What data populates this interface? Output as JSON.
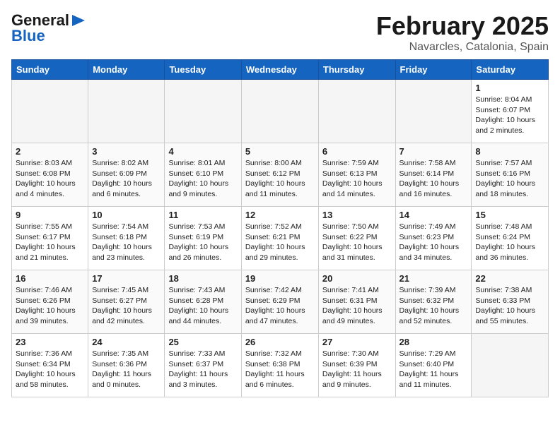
{
  "logo": {
    "line1": "General",
    "line2": "Blue",
    "arrow": "▶"
  },
  "title": "February 2025",
  "location": "Navarcles, Catalonia, Spain",
  "weekdays": [
    "Sunday",
    "Monday",
    "Tuesday",
    "Wednesday",
    "Thursday",
    "Friday",
    "Saturday"
  ],
  "weeks": [
    [
      {
        "day": "",
        "info": ""
      },
      {
        "day": "",
        "info": ""
      },
      {
        "day": "",
        "info": ""
      },
      {
        "day": "",
        "info": ""
      },
      {
        "day": "",
        "info": ""
      },
      {
        "day": "",
        "info": ""
      },
      {
        "day": "1",
        "info": "Sunrise: 8:04 AM\nSunset: 6:07 PM\nDaylight: 10 hours and 2 minutes."
      }
    ],
    [
      {
        "day": "2",
        "info": "Sunrise: 8:03 AM\nSunset: 6:08 PM\nDaylight: 10 hours and 4 minutes."
      },
      {
        "day": "3",
        "info": "Sunrise: 8:02 AM\nSunset: 6:09 PM\nDaylight: 10 hours and 6 minutes."
      },
      {
        "day": "4",
        "info": "Sunrise: 8:01 AM\nSunset: 6:10 PM\nDaylight: 10 hours and 9 minutes."
      },
      {
        "day": "5",
        "info": "Sunrise: 8:00 AM\nSunset: 6:12 PM\nDaylight: 10 hours and 11 minutes."
      },
      {
        "day": "6",
        "info": "Sunrise: 7:59 AM\nSunset: 6:13 PM\nDaylight: 10 hours and 14 minutes."
      },
      {
        "day": "7",
        "info": "Sunrise: 7:58 AM\nSunset: 6:14 PM\nDaylight: 10 hours and 16 minutes."
      },
      {
        "day": "8",
        "info": "Sunrise: 7:57 AM\nSunset: 6:16 PM\nDaylight: 10 hours and 18 minutes."
      }
    ],
    [
      {
        "day": "9",
        "info": "Sunrise: 7:55 AM\nSunset: 6:17 PM\nDaylight: 10 hours and 21 minutes."
      },
      {
        "day": "10",
        "info": "Sunrise: 7:54 AM\nSunset: 6:18 PM\nDaylight: 10 hours and 23 minutes."
      },
      {
        "day": "11",
        "info": "Sunrise: 7:53 AM\nSunset: 6:19 PM\nDaylight: 10 hours and 26 minutes."
      },
      {
        "day": "12",
        "info": "Sunrise: 7:52 AM\nSunset: 6:21 PM\nDaylight: 10 hours and 29 minutes."
      },
      {
        "day": "13",
        "info": "Sunrise: 7:50 AM\nSunset: 6:22 PM\nDaylight: 10 hours and 31 minutes."
      },
      {
        "day": "14",
        "info": "Sunrise: 7:49 AM\nSunset: 6:23 PM\nDaylight: 10 hours and 34 minutes."
      },
      {
        "day": "15",
        "info": "Sunrise: 7:48 AM\nSunset: 6:24 PM\nDaylight: 10 hours and 36 minutes."
      }
    ],
    [
      {
        "day": "16",
        "info": "Sunrise: 7:46 AM\nSunset: 6:26 PM\nDaylight: 10 hours and 39 minutes."
      },
      {
        "day": "17",
        "info": "Sunrise: 7:45 AM\nSunset: 6:27 PM\nDaylight: 10 hours and 42 minutes."
      },
      {
        "day": "18",
        "info": "Sunrise: 7:43 AM\nSunset: 6:28 PM\nDaylight: 10 hours and 44 minutes."
      },
      {
        "day": "19",
        "info": "Sunrise: 7:42 AM\nSunset: 6:29 PM\nDaylight: 10 hours and 47 minutes."
      },
      {
        "day": "20",
        "info": "Sunrise: 7:41 AM\nSunset: 6:31 PM\nDaylight: 10 hours and 49 minutes."
      },
      {
        "day": "21",
        "info": "Sunrise: 7:39 AM\nSunset: 6:32 PM\nDaylight: 10 hours and 52 minutes."
      },
      {
        "day": "22",
        "info": "Sunrise: 7:38 AM\nSunset: 6:33 PM\nDaylight: 10 hours and 55 minutes."
      }
    ],
    [
      {
        "day": "23",
        "info": "Sunrise: 7:36 AM\nSunset: 6:34 PM\nDaylight: 10 hours and 58 minutes."
      },
      {
        "day": "24",
        "info": "Sunrise: 7:35 AM\nSunset: 6:36 PM\nDaylight: 11 hours and 0 minutes."
      },
      {
        "day": "25",
        "info": "Sunrise: 7:33 AM\nSunset: 6:37 PM\nDaylight: 11 hours and 3 minutes."
      },
      {
        "day": "26",
        "info": "Sunrise: 7:32 AM\nSunset: 6:38 PM\nDaylight: 11 hours and 6 minutes."
      },
      {
        "day": "27",
        "info": "Sunrise: 7:30 AM\nSunset: 6:39 PM\nDaylight: 11 hours and 9 minutes."
      },
      {
        "day": "28",
        "info": "Sunrise: 7:29 AM\nSunset: 6:40 PM\nDaylight: 11 hours and 11 minutes."
      },
      {
        "day": "",
        "info": ""
      }
    ]
  ]
}
